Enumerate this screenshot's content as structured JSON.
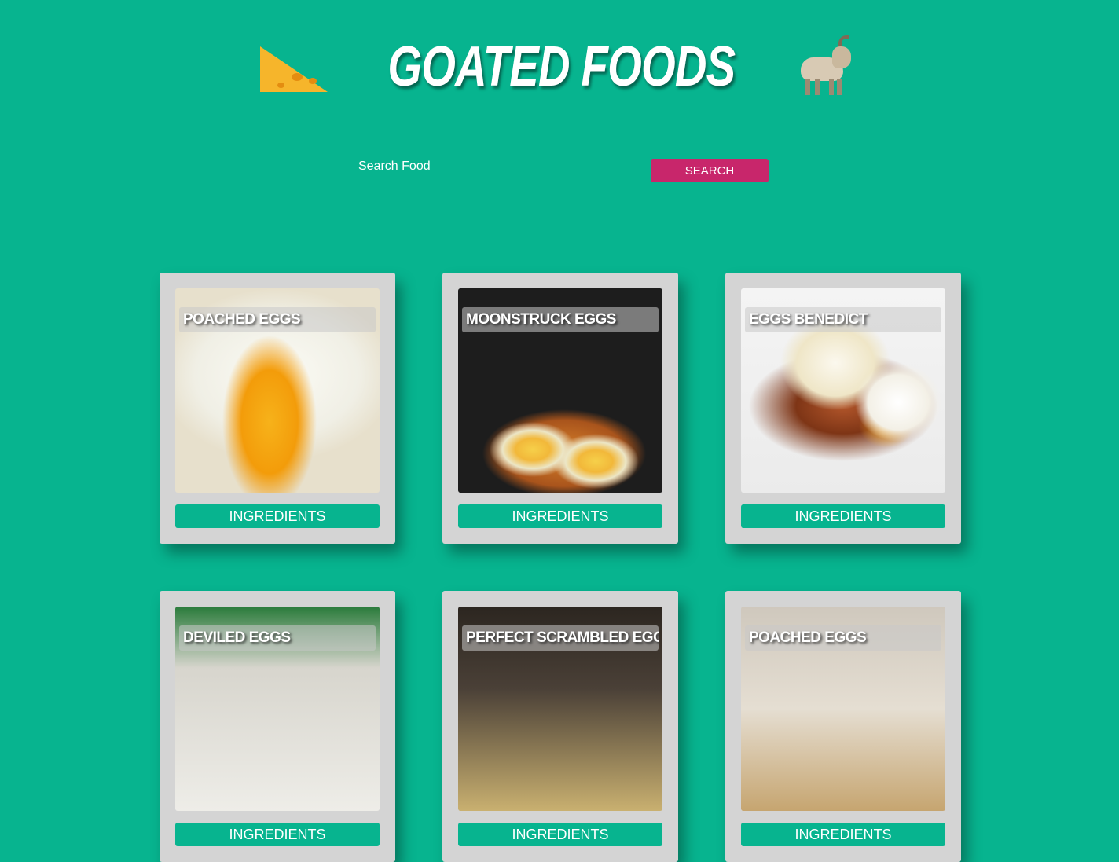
{
  "header": {
    "title": "GOATED FOODS",
    "left_icon": "cheese-icon",
    "right_icon": "goat-icon"
  },
  "search": {
    "placeholder": "Search Food",
    "value": "",
    "button_label": "SEARCH"
  },
  "colors": {
    "background": "#07b48f",
    "search_button": "#c8266b",
    "card": "#d4d4d4",
    "ingredients_button": "#07b48f"
  },
  "recipes": [
    {
      "title": "POACHED EGGS",
      "button_label": "INGREDIENTS"
    },
    {
      "title": "MOONSTRUCK EGGS",
      "button_label": "INGREDIENTS"
    },
    {
      "title": "EGGS BENEDICT",
      "button_label": "INGREDIENTS"
    },
    {
      "title": "DEVILED EGGS",
      "button_label": "INGREDIENTS"
    },
    {
      "title": "PERFECT SCRAMBLED EGGS",
      "button_label": "INGREDIENTS"
    },
    {
      "title": "POACHED EGGS",
      "button_label": "INGREDIENTS"
    }
  ]
}
